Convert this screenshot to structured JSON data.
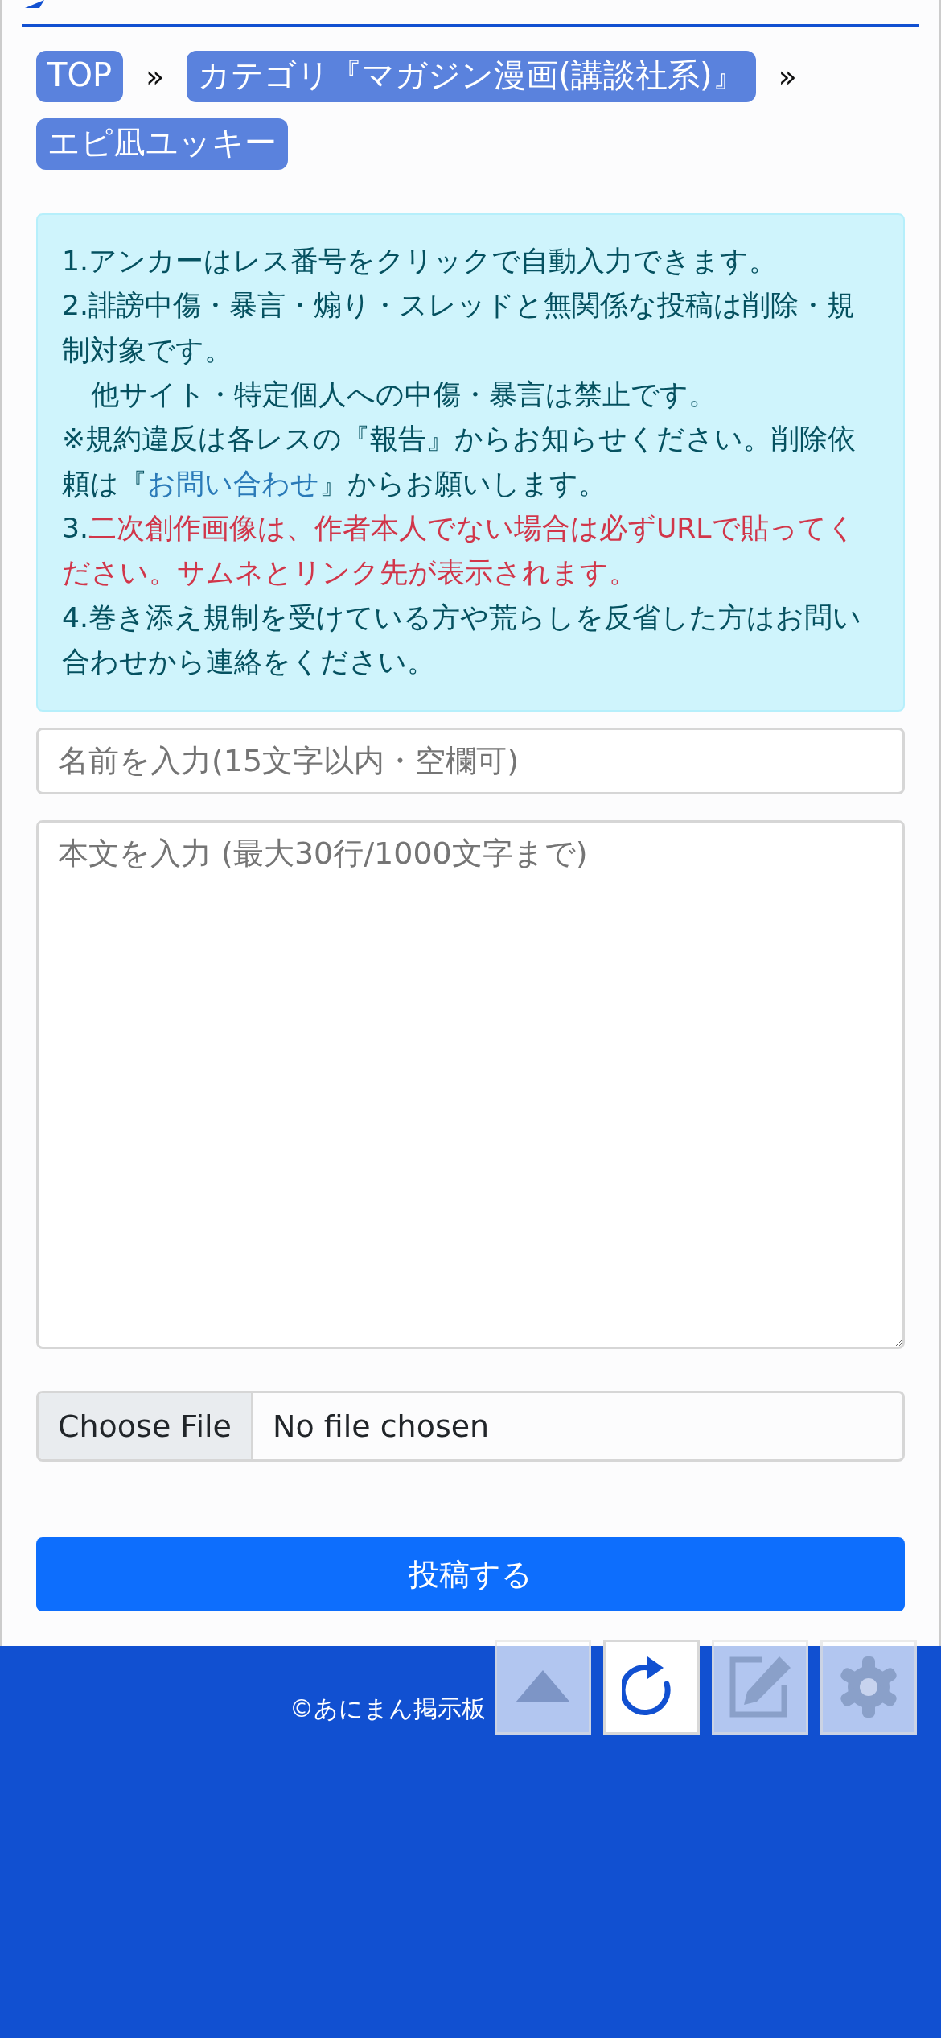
{
  "breadcrumbs": [
    {
      "label": "TOP"
    },
    {
      "label": "カテゴリ『マガジン漫画(講談社系)』"
    },
    {
      "label": "エピ凪ユッキー"
    }
  ],
  "breadcrumb_separator": "»",
  "notice": [
    {
      "indent": false,
      "segments": [
        {
          "kind": "plain",
          "text": "1.アンカーはレス番号をクリックで自動入力できます。"
        }
      ]
    },
    {
      "indent": false,
      "segments": [
        {
          "kind": "plain",
          "text": "2.誹謗中傷・暴言・煽り・スレッドと無関係な投稿は削除・規制対象です。"
        }
      ]
    },
    {
      "indent": true,
      "segments": [
        {
          "kind": "plain",
          "text": "他サイト・特定個人への中傷・暴言は禁止です。"
        }
      ]
    },
    {
      "indent": false,
      "segments": [
        {
          "kind": "plain",
          "text": "※規約違反は各レスの『報告』からお知らせください。削除依頼は『"
        },
        {
          "kind": "link",
          "text": "お問い合わせ"
        },
        {
          "kind": "plain",
          "text": "』からお願いします。"
        }
      ]
    },
    {
      "indent": false,
      "segments": [
        {
          "kind": "plain",
          "text": "3."
        },
        {
          "kind": "alert",
          "text": "二次創作画像は、作者本人でない場合は必ずURLで貼ってください。サムネとリンク先が表示されます。"
        }
      ]
    },
    {
      "indent": false,
      "segments": [
        {
          "kind": "plain",
          "text": "4.巻き添え規制を受けている方や荒らしを反省した方はお問い合わせから連絡をください。"
        }
      ]
    }
  ],
  "name_field": {
    "placeholder": "名前を入力(15文字以内・空欄可)"
  },
  "body_field": {
    "placeholder": "本文を入力 (最大30行/1000文字まで)"
  },
  "file_input": {
    "button": "Choose File",
    "status": "No file chosen"
  },
  "submit_button": "投稿する",
  "footer": {
    "copyright": "©あにまん掲示板"
  },
  "floating_buttons": [
    {
      "kind": "up",
      "active": false
    },
    {
      "kind": "reload",
      "active": true
    },
    {
      "kind": "edit",
      "active": false
    },
    {
      "kind": "settings",
      "active": false
    }
  ]
}
